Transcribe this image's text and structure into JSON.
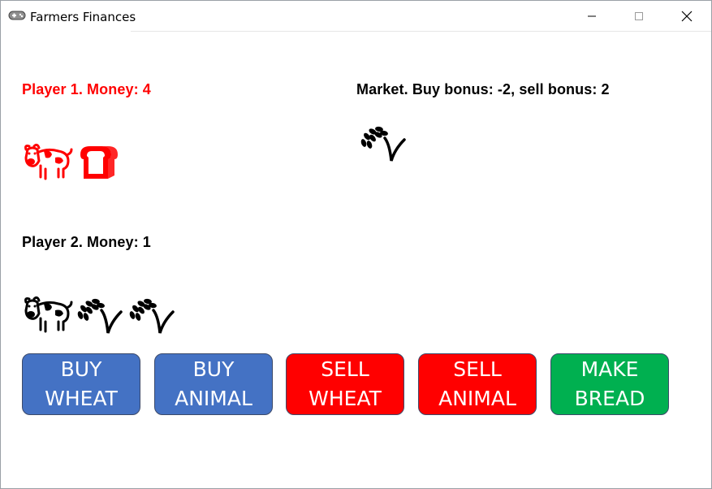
{
  "window": {
    "title": "Farmers Finances"
  },
  "player1": {
    "label": "Player 1. Money: 4",
    "color": "#ff0000",
    "items": [
      "cow-icon",
      "bread-icon"
    ]
  },
  "market": {
    "label": "Market. Buy bonus: -2, sell bonus: 2",
    "items": [
      "wheat-icon"
    ]
  },
  "player2": {
    "label": "Player 2. Money: 1",
    "color": "#000000",
    "items": [
      "cow-icon",
      "wheat-icon",
      "wheat-icon"
    ]
  },
  "buttons": [
    {
      "line1": "BUY",
      "line2": "WHEAT",
      "color": "#4472c4"
    },
    {
      "line1": "BUY",
      "line2": "ANIMAL",
      "color": "#4472c4"
    },
    {
      "line1": "SELL",
      "line2": "WHEAT",
      "color": "#ff0000"
    },
    {
      "line1": "SELL",
      "line2": "ANIMAL",
      "color": "#ff0000"
    },
    {
      "line1": "MAKE",
      "line2": "BREAD",
      "color": "#00b050"
    }
  ]
}
